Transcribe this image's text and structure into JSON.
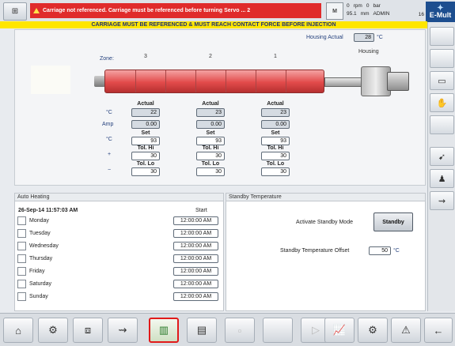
{
  "topbar": {
    "alarm_text": "Carriage not referenced. Carriage must be referenced before turning Servo ... 2",
    "status": {
      "row1": [
        "0",
        "rpm",
        "0",
        "bar"
      ],
      "row2": [
        "95.1",
        "mm",
        "ADMIN"
      ],
      "level": "16"
    },
    "logo": "E-Mult"
  },
  "banner": "CARRIAGE MUST BE REFERENCED & MUST REACH CONTACT FORCE BEFORE INJECTION",
  "main": {
    "housing_label": "Housing Actual",
    "housing_value": "28",
    "housing_unit": "°C",
    "housing_caption": "Housing",
    "zone_label": "Zone:",
    "zones": [
      "3",
      "2",
      "1"
    ],
    "row_labels": {
      "temp": "°C",
      "amp": "Amp",
      "set_unit": "°C",
      "plus": "+",
      "minus": "−"
    },
    "col_headers": {
      "actual": "Actual",
      "set": "Set",
      "tol_hi": "Tol. Hi",
      "tol_lo": "Tol. Lo"
    },
    "columns": [
      {
        "actual": "22",
        "amp": "0.00",
        "set": "93",
        "tol_hi": "30",
        "tol_lo": "30"
      },
      {
        "actual": "23",
        "amp": "0.00",
        "set": "93",
        "tol_hi": "30",
        "tol_lo": "30"
      },
      {
        "actual": "23",
        "amp": "0.00",
        "set": "93",
        "tol_hi": "30",
        "tol_lo": "30"
      }
    ]
  },
  "auto_heating": {
    "title": "Auto Heating",
    "datetime": "26-Sep-14 11:57:03 AM",
    "start_label": "Start",
    "days": [
      {
        "name": "Monday",
        "time": "12:00:00 AM"
      },
      {
        "name": "Tuesday",
        "time": "12:00:00 AM"
      },
      {
        "name": "Wednesday",
        "time": "12:00:00 AM"
      },
      {
        "name": "Thursday",
        "time": "12:00:00 AM"
      },
      {
        "name": "Friday",
        "time": "12:00:00 AM"
      },
      {
        "name": "Saturday",
        "time": "12:00:00 AM"
      },
      {
        "name": "Sunday",
        "time": "12:00:00 AM"
      }
    ]
  },
  "standby": {
    "title": "Standby Temperature",
    "activate_label": "Activate Standby Mode",
    "button_label": "Standby",
    "offset_label": "Standby Temperature Offset",
    "offset_value": "50",
    "offset_unit": "°C"
  },
  "right_buttons": [
    "empty-icon",
    "empty-icon",
    "split-view-icon",
    "hand-icon",
    "empty-icon",
    "injection-icon",
    "operator-icon",
    "screw-icon"
  ],
  "bottom_buttons": [
    "home-icon",
    "tool-icon",
    "mold-icon",
    "screw-icon",
    "heater-icon",
    "production-icon",
    "blank-icon",
    "blank-icon",
    "blank-icon",
    "chart-icon",
    "settings-icon",
    "alarm-icon",
    "back-icon"
  ]
}
